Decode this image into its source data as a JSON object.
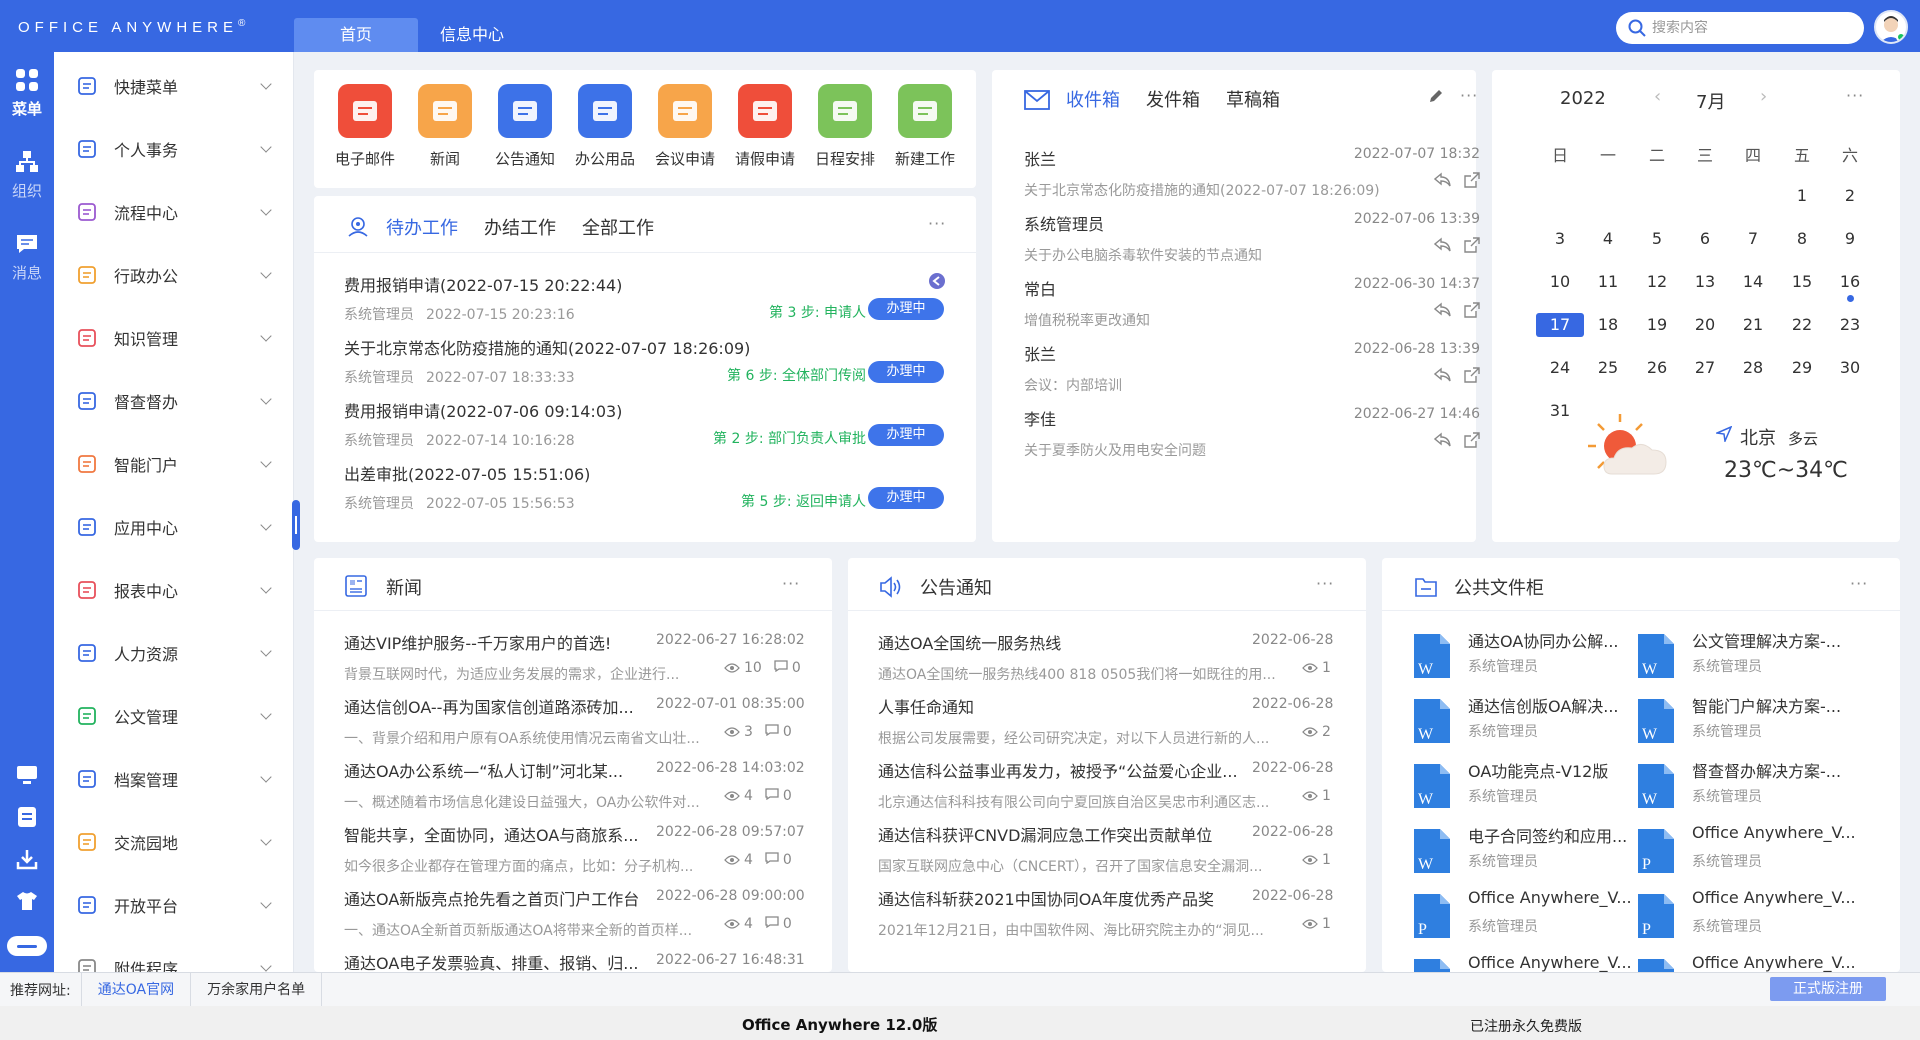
{
  "brand": {
    "name": "Office Anywhere",
    "reg": "®"
  },
  "tabs": [
    {
      "label": "首页"
    },
    {
      "label": "信息中心"
    }
  ],
  "search": {
    "placeholder": "搜索内容"
  },
  "rail": [
    {
      "label": "菜单",
      "icon": "grid-icon"
    },
    {
      "label": "组织",
      "icon": "org-icon"
    },
    {
      "label": "消息",
      "icon": "message-icon"
    }
  ],
  "rail_bottom": [
    "monitor-icon",
    "note-icon",
    "download-icon",
    "shirt-icon",
    "more-icon"
  ],
  "menu": [
    {
      "label": "快捷菜单",
      "icon": "quick-menu-icon",
      "color": "#3768e2"
    },
    {
      "label": "个人事务",
      "icon": "person-icon",
      "color": "#3768e2"
    },
    {
      "label": "流程中心",
      "icon": "flow-icon",
      "color": "#9b59d0"
    },
    {
      "label": "行政办公",
      "icon": "briefcase-icon",
      "color": "#f0a030"
    },
    {
      "label": "知识管理",
      "icon": "book-icon",
      "color": "#e8505b"
    },
    {
      "label": "督查督办",
      "icon": "check-doc-icon",
      "color": "#3768e2"
    },
    {
      "label": "智能门户",
      "icon": "portal-icon",
      "color": "#f07840"
    },
    {
      "label": "应用中心",
      "icon": "app-center-icon",
      "color": "#3768e2"
    },
    {
      "label": "报表中心",
      "icon": "bar-chart-icon",
      "color": "#e8505b"
    },
    {
      "label": "人力资源",
      "icon": "people-icon",
      "color": "#3768e2"
    },
    {
      "label": "公文管理",
      "icon": "folder-icon",
      "color": "#22b35e"
    },
    {
      "label": "档案管理",
      "icon": "archive-icon",
      "color": "#3768e2"
    },
    {
      "label": "交流园地",
      "icon": "cup-icon",
      "color": "#f0a030"
    },
    {
      "label": "开放平台",
      "icon": "cube-icon",
      "color": "#3768e2"
    },
    {
      "label": "附件程序",
      "icon": "clip-icon",
      "color": "#888888"
    }
  ],
  "apps": [
    {
      "label": "电子邮件",
      "icon": "mail-icon",
      "color": "#ef4e3a"
    },
    {
      "label": "新闻",
      "icon": "news-icon",
      "color": "#f7a54a"
    },
    {
      "label": "公告通知",
      "icon": "speaker-icon",
      "color": "#3d72e8"
    },
    {
      "label": "办公用品",
      "icon": "supplies-icon",
      "color": "#3d72e8"
    },
    {
      "label": "会议申请",
      "icon": "meeting-icon",
      "color": "#f7a54a"
    },
    {
      "label": "请假申请",
      "icon": "leave-icon",
      "color": "#ef4e3a"
    },
    {
      "label": "日程安排",
      "icon": "schedule-icon",
      "color": "#7cc35a"
    },
    {
      "label": "新建工作",
      "icon": "new-work-icon",
      "color": "#7cc35a"
    }
  ],
  "todo": {
    "tabs": [
      "待办工作",
      "办结工作",
      "全部工作"
    ],
    "btn_label": "办理中",
    "items": [
      {
        "title": "费用报销申请(2022-07-15 20:22:44)",
        "user": "系统管理员",
        "time": "2022-07-15 20:23:16",
        "step": "第 3 步: 申请人"
      },
      {
        "title": "关于北京常态化防疫措施的通知(2022-07-07 18:26:09)",
        "user": "系统管理员",
        "time": "2022-07-07 18:33:33",
        "step": "第 6 步: 全体部门传阅"
      },
      {
        "title": "费用报销申请(2022-07-06 09:14:03)",
        "user": "系统管理员",
        "time": "2022-07-14 10:16:28",
        "step": "第 2 步: 部门负责人审批"
      },
      {
        "title": "出差审批(2022-07-05 15:51:06)",
        "user": "系统管理员",
        "time": "2022-07-05 15:56:53",
        "step": "第 5 步: 返回申请人"
      }
    ]
  },
  "mail": {
    "tabs": [
      "收件箱",
      "发件箱",
      "草稿箱"
    ],
    "items": [
      {
        "sender": "张兰",
        "time": "2022-07-07 18:32",
        "subject": "关于北京常态化防疫措施的通知(2022-07-07 18:26:09)"
      },
      {
        "sender": "系统管理员",
        "time": "2022-07-06 13:39",
        "subject": "关于办公电脑杀毒软件安装的节点通知"
      },
      {
        "sender": "常白",
        "time": "2022-06-30 14:37",
        "subject": "增值税税率更改通知"
      },
      {
        "sender": "张兰",
        "time": "2022-06-28 13:39",
        "subject": "会议：内部培训"
      },
      {
        "sender": "李佳",
        "time": "2022-06-27 14:46",
        "subject": "关于夏季防火及用电安全问题"
      }
    ]
  },
  "calendar": {
    "year": "2022",
    "month": "7月",
    "weekdays": [
      "日",
      "一",
      "二",
      "三",
      "四",
      "五",
      "六"
    ],
    "rows": [
      [
        "",
        "",
        "",
        "",
        "",
        "1",
        "2"
      ],
      [
        "3",
        "4",
        "5",
        "6",
        "7",
        "8",
        "9"
      ],
      [
        "10",
        "11",
        "12",
        "13",
        "14",
        "15",
        "16"
      ],
      [
        "17",
        "18",
        "19",
        "20",
        "21",
        "22",
        "23"
      ],
      [
        "24",
        "25",
        "26",
        "27",
        "28",
        "29",
        "30"
      ],
      [
        "31",
        "",
        "",
        "",
        "",
        "",
        ""
      ]
    ],
    "today": "17",
    "marked": [
      "16"
    ],
    "weather": {
      "city": "北京",
      "cond": "多云",
      "temp": "23℃~34℃",
      "icon": "partly-cloudy-icon"
    }
  },
  "news": {
    "title": "新闻",
    "items": [
      {
        "title": "通达VIP维护服务--千万家用户的首选!",
        "date": "2022-06-27 16:28:02",
        "sub": "背景互联网时代，为适应业务发展的需求，企业进行...",
        "views": "10",
        "comments": "0"
      },
      {
        "title": "通达信创OA--再为国家信创道路添砖加...",
        "date": "2022-07-01 08:35:00",
        "sub": "一、背景介绍和用户原有OA系统使用情况云南省文山壮...",
        "views": "3",
        "comments": "0"
      },
      {
        "title": "通达OA办公系统—“私人订制”河北某...",
        "date": "2022-06-28 14:03:02",
        "sub": "一、概述随着市场信息化建设日益强大，OA办公软件对...",
        "views": "4",
        "comments": "0"
      },
      {
        "title": "智能共享，全面协同，通达OA与商旅系...",
        "date": "2022-06-28 09:57:07",
        "sub": "如今很多企业都存在管理方面的痛点，比如：分子机构...",
        "views": "4",
        "comments": "0"
      },
      {
        "title": "通达OA新版亮点抢先看之首页门户工作台",
        "date": "2022-06-28 09:00:00",
        "sub": "一、通达OA全新首页新版通达OA将带来全新的首页样...",
        "views": "4",
        "comments": "0"
      },
      {
        "title": "通达OA电子发票验真、排重、报销、归...",
        "date": "2022-06-27 16:48:31",
        "sub": "",
        "views": "",
        "comments": ""
      }
    ]
  },
  "notice": {
    "title": "公告通知",
    "items": [
      {
        "title": "通达OA全国统一服务热线",
        "date": "2022-06-28",
        "sub": "通达OA全国统一服务热线400 818 0505我们将一如既往的用...",
        "views": "1"
      },
      {
        "title": "人事任命通知",
        "date": "2022-06-28",
        "sub": "根据公司发展需要，经公司研究决定，对以下人员进行新的人...",
        "views": "2"
      },
      {
        "title": "通达信科公益事业再发力，被授予“公益爱心企业...",
        "date": "2022-06-28",
        "sub": "北京通达信科科技有限公司向宁夏回族自治区吴忠市利通区志...",
        "views": "1"
      },
      {
        "title": "通达信科获评CNVD漏洞应急工作突出贡献单位",
        "date": "2022-06-28",
        "sub": "国家互联网应急中心（CNCERT），召开了国家信息安全漏洞...",
        "views": "1"
      },
      {
        "title": "通达信科斩获2021中国协同OA年度优秀产品奖",
        "date": "2022-06-28",
        "sub": "2021年12月21日，由中国软件网、海比研究院主办的“洞见...",
        "views": "1"
      }
    ]
  },
  "files": {
    "title": "公共文件柜",
    "items": [
      {
        "name": "通达OA协同办公解...",
        "owner": "系统管理员",
        "type": "W"
      },
      {
        "name": "公文管理解决方案-...",
        "owner": "系统管理员",
        "type": "W"
      },
      {
        "name": "通达信创版OA解决...",
        "owner": "系统管理员",
        "type": "W"
      },
      {
        "name": "智能门户解决方案-...",
        "owner": "系统管理员",
        "type": "W"
      },
      {
        "name": "OA功能亮点-V12版",
        "owner": "系统管理员",
        "type": "W"
      },
      {
        "name": "督查督办解决方案-...",
        "owner": "系统管理员",
        "type": "W"
      },
      {
        "name": "电子合同签约和应用...",
        "owner": "系统管理员",
        "type": "W"
      },
      {
        "name": "Office Anywhere_V...",
        "owner": "系统管理员",
        "type": "P"
      },
      {
        "name": "Office Anywhere_V...",
        "owner": "系统管理员",
        "type": "P"
      },
      {
        "name": "Office Anywhere_V...",
        "owner": "系统管理员",
        "type": "P"
      },
      {
        "name": "Office Anywhere_V...",
        "owner": "",
        "type": "P"
      },
      {
        "name": "Office Anywhere_V...",
        "owner": "",
        "type": "P"
      }
    ]
  },
  "recommend": {
    "label": "推荐网址:",
    "links": [
      "通达OA官网",
      "万余家用户名单"
    ],
    "register": "正式版注册"
  },
  "status": {
    "version": "Office Anywhere 12.0版",
    "license": "已注册永久免费版"
  },
  "colors": {
    "primary": "#3768e2",
    "step_green": "#22b35e"
  }
}
